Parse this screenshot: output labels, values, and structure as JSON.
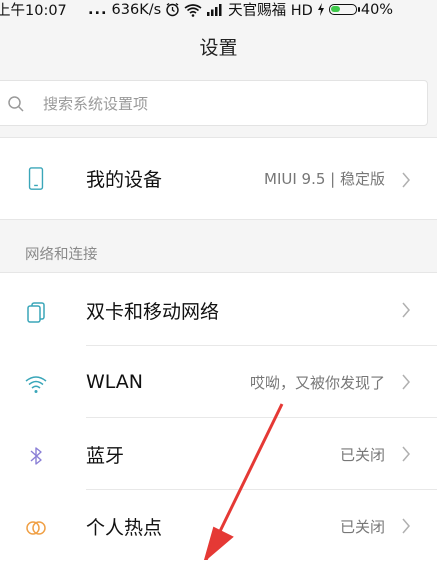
{
  "status_bar": {
    "time": "上午10:07",
    "dots": "...",
    "speed": "636K/s",
    "carrier": "天官赐福 HD",
    "battery": "40%",
    "battery_level": 0.4
  },
  "title": "设置",
  "search": {
    "placeholder": "搜索系统设置项"
  },
  "device": {
    "label": "我的设备",
    "value": "MIUI 9.5 | 稳定版"
  },
  "section_network": "网络和连接",
  "network_items": [
    {
      "label": "双卡和移动网络",
      "value": "",
      "icon": "dual-sim-icon"
    },
    {
      "label": "WLAN",
      "value": "哎呦，又被你发现了",
      "icon": "wifi-icon"
    },
    {
      "label": "蓝牙",
      "value": "已关闭",
      "icon": "bluetooth-icon"
    },
    {
      "label": "个人热点",
      "value": "已关闭",
      "icon": "hotspot-icon"
    }
  ],
  "colors": {
    "accent": "#3aa6b9",
    "annotation": "#e53935"
  }
}
